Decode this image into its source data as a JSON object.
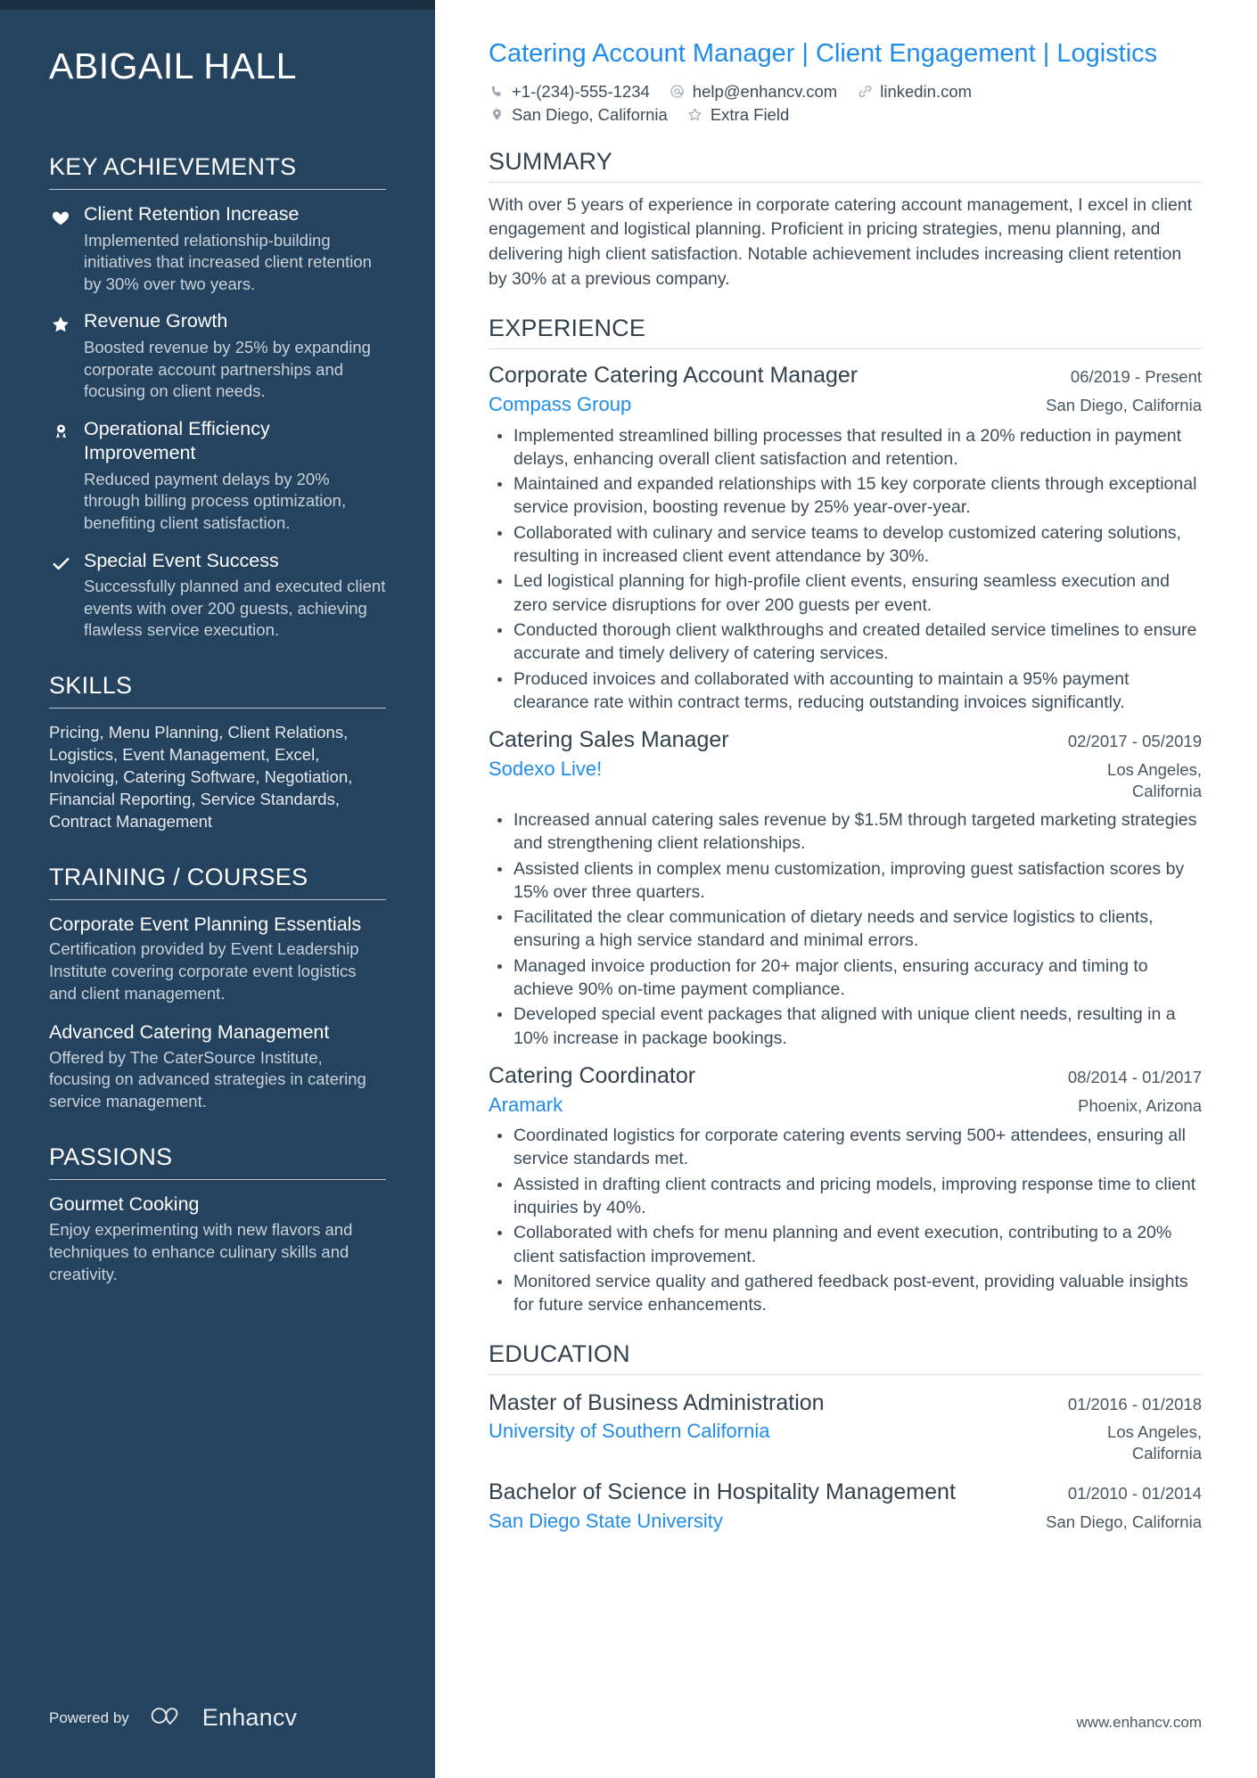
{
  "sidebar": {
    "name": "ABIGAIL HALL",
    "key_achievements": {
      "heading": "KEY ACHIEVEMENTS",
      "items": [
        {
          "icon": "heart-icon",
          "title": "Client Retention Increase",
          "description": "Implemented relationship-building initiatives that increased client retention by 30% over two years."
        },
        {
          "icon": "star-icon",
          "title": "Revenue Growth",
          "description": "Boosted revenue by 25% by expanding corporate account partnerships and focusing on client needs."
        },
        {
          "icon": "award-ribbon-icon",
          "title": "Operational Efficiency Improvement",
          "description": "Reduced payment delays by 20% through billing process optimization, benefiting client satisfaction."
        },
        {
          "icon": "check-icon",
          "title": "Special Event Success",
          "description": "Successfully planned and executed client events with over 200 guests, achieving flawless service execution."
        }
      ]
    },
    "skills": {
      "heading": "SKILLS",
      "text": "Pricing, Menu Planning, Client Relations, Logistics, Event Management, Excel, Invoicing, Catering Software, Negotiation, Financial Reporting, Service Standards, Contract Management"
    },
    "training": {
      "heading": "TRAINING / COURSES",
      "items": [
        {
          "title": "Corporate Event Planning Essentials",
          "description": "Certification provided by Event Leadership Institute covering corporate event logistics and client management."
        },
        {
          "title": "Advanced Catering Management",
          "description": "Offered by The CaterSource Institute, focusing on advanced strategies in catering service management."
        }
      ]
    },
    "passions": {
      "heading": "PASSIONS",
      "items": [
        {
          "title": "Gourmet Cooking",
          "description": "Enjoy experimenting with new flavors and techniques to enhance culinary skills and creativity."
        }
      ]
    },
    "footer": {
      "powered_by": "Powered by",
      "brand": "Enhancv"
    }
  },
  "main": {
    "headline": "Catering Account Manager | Client Engagement | Logistics",
    "contacts_row1": [
      {
        "icon": "phone-icon",
        "text": "+1-(234)-555-1234"
      },
      {
        "icon": "email-icon",
        "text": "help@enhancv.com"
      },
      {
        "icon": "link-icon",
        "text": "linkedin.com"
      }
    ],
    "contacts_row2": [
      {
        "icon": "location-pin-icon",
        "text": "San Diego, California"
      },
      {
        "icon": "star-outline-icon",
        "text": "Extra Field"
      }
    ],
    "summary": {
      "heading": "SUMMARY",
      "text": "With over 5 years of experience in corporate catering account management, I excel in client engagement and logistical planning. Proficient in pricing strategies, menu planning, and delivering high client satisfaction. Notable achievement includes increasing client retention by 30% at a previous company."
    },
    "experience": {
      "heading": "EXPERIENCE",
      "entries": [
        {
          "title": "Corporate Catering Account Manager",
          "date": "06/2019 - Present",
          "organization": "Compass Group",
          "location": "San Diego, California",
          "bullets": [
            "Implemented streamlined billing processes that resulted in a 20% reduction in payment delays, enhancing overall client satisfaction and retention.",
            "Maintained and expanded relationships with 15 key corporate clients through exceptional service provision, boosting revenue by 25% year-over-year.",
            "Collaborated with culinary and service teams to develop customized catering solutions, resulting in increased client event attendance by 30%.",
            "Led logistical planning for high-profile client events, ensuring seamless execution and zero service disruptions for over 200 guests per event.",
            "Conducted thorough client walkthroughs and created detailed service timelines to ensure accurate and timely delivery of catering services.",
            "Produced invoices and collaborated with accounting to maintain a 95% payment clearance rate within contract terms, reducing outstanding invoices significantly."
          ]
        },
        {
          "title": "Catering Sales Manager",
          "date": "02/2017 - 05/2019",
          "organization": "Sodexo Live!",
          "location": "Los Angeles, California",
          "bullets": [
            "Increased annual catering sales revenue by $1.5M through targeted marketing strategies and strengthening client relationships.",
            "Assisted clients in complex menu customization, improving guest satisfaction scores by 15% over three quarters.",
            "Facilitated the clear communication of dietary needs and service logistics to clients, ensuring a high service standard and minimal errors.",
            "Managed invoice production for 20+ major clients, ensuring accuracy and timing to achieve 90% on-time payment compliance.",
            "Developed special event packages that aligned with unique client needs, resulting in a 10% increase in package bookings."
          ]
        },
        {
          "title": "Catering Coordinator",
          "date": "08/2014 - 01/2017",
          "organization": "Aramark",
          "location": "Phoenix, Arizona",
          "bullets": [
            "Coordinated logistics for corporate catering events serving 500+ attendees, ensuring all service standards met.",
            "Assisted in drafting client contracts and pricing models, improving response time to client inquiries by 40%.",
            "Collaborated with chefs for menu planning and event execution, contributing to a 20% client satisfaction improvement.",
            "Monitored service quality and gathered feedback post-event, providing valuable insights for future service enhancements."
          ]
        }
      ]
    },
    "education": {
      "heading": "EDUCATION",
      "entries": [
        {
          "title": "Master of Business Administration",
          "date": "01/2016 - 01/2018",
          "organization": "University of Southern California",
          "location": "Los Angeles, California"
        },
        {
          "title": "Bachelor of Science in Hospitality Management",
          "date": "01/2010 - 01/2014",
          "organization": "San Diego State University",
          "location": "San Diego, California"
        }
      ]
    },
    "site_url": "www.enhancv.com"
  },
  "colors": {
    "sidebar_bg": "#25435f",
    "sidebar_topbar": "#1b2f42",
    "accent_blue": "#1f8ceb",
    "body_text": "#3d4b58"
  }
}
